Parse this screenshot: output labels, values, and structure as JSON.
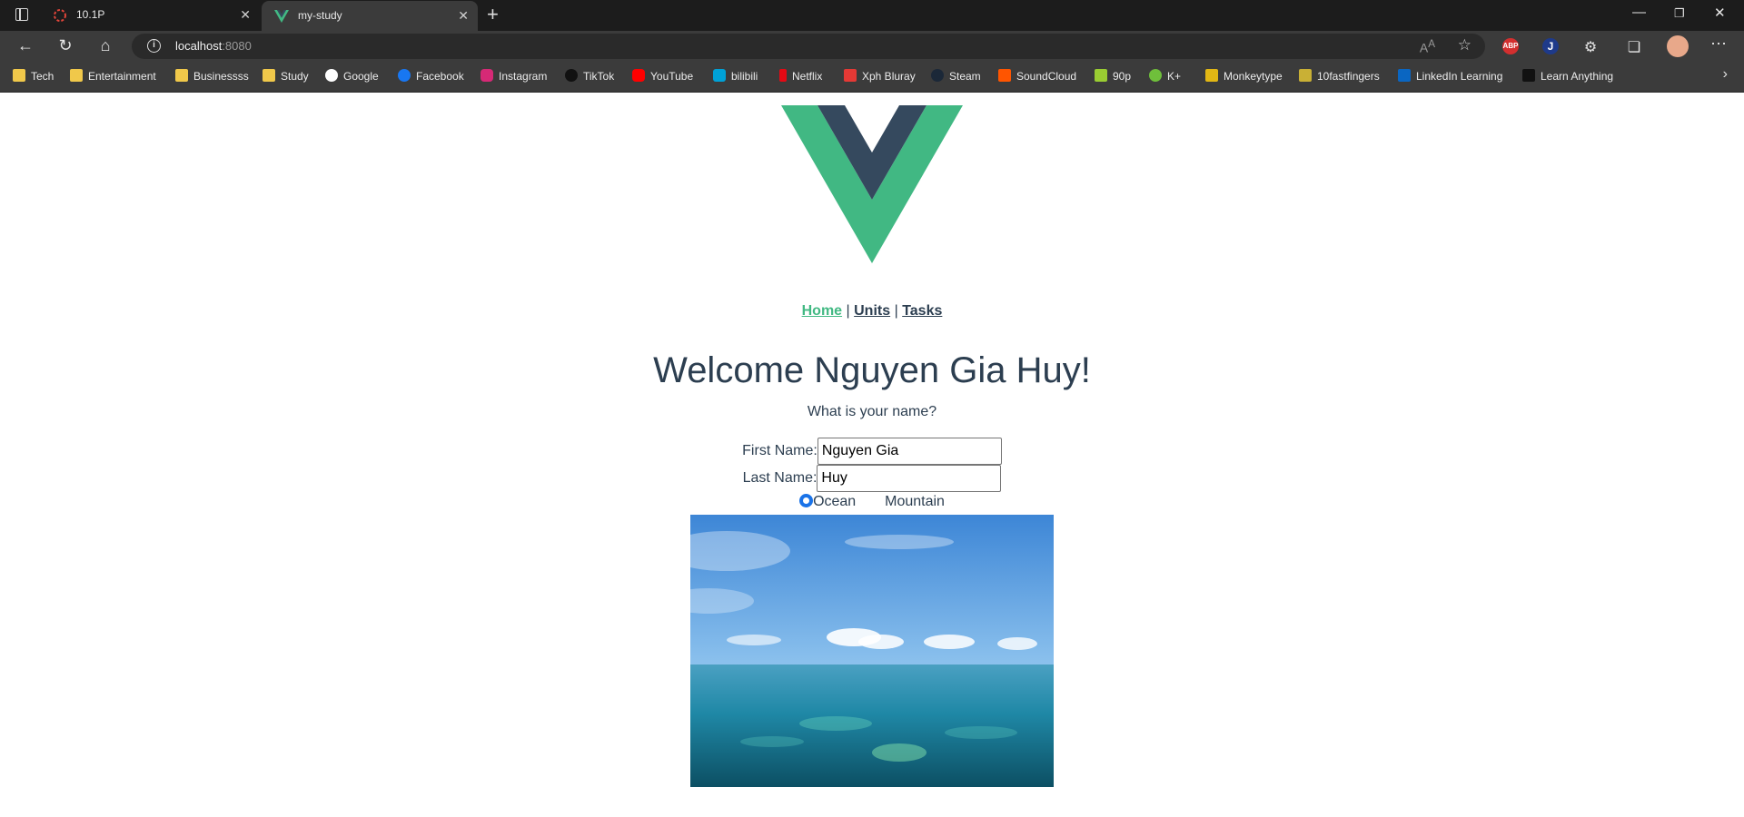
{
  "browser": {
    "tabs": [
      {
        "title": "10.1P",
        "active": false
      },
      {
        "title": "my-study",
        "active": true
      }
    ],
    "address": {
      "host": "localhost",
      "port": ":8080"
    },
    "bookmarks": [
      {
        "label": "Tech",
        "icon": "folder-icon"
      },
      {
        "label": "Entertainment",
        "icon": "folder-icon"
      },
      {
        "label": "Businessss",
        "icon": "folder-icon"
      },
      {
        "label": "Study",
        "icon": "folder-icon"
      },
      {
        "label": "Google",
        "icon": "google-icon"
      },
      {
        "label": "Facebook",
        "icon": "facebook-icon"
      },
      {
        "label": "Instagram",
        "icon": "instagram-icon"
      },
      {
        "label": "TikTok",
        "icon": "tiktok-icon"
      },
      {
        "label": "YouTube",
        "icon": "youtube-icon"
      },
      {
        "label": "bilibili",
        "icon": "bilibili-icon"
      },
      {
        "label": "Netflix",
        "icon": "netflix-icon"
      },
      {
        "label": "Xph Bluray",
        "icon": "xph-icon"
      },
      {
        "label": "Steam",
        "icon": "steam-icon"
      },
      {
        "label": "SoundCloud",
        "icon": "soundcloud-icon"
      },
      {
        "label": "90p",
        "icon": "90p-icon"
      },
      {
        "label": "K+",
        "icon": "kplus-icon"
      },
      {
        "label": "Monkeytype",
        "icon": "monkeytype-icon"
      },
      {
        "label": "10fastfingers",
        "icon": "10fastfingers-icon"
      },
      {
        "label": "LinkedIn Learning",
        "icon": "linkedin-learning-icon"
      },
      {
        "label": "Learn Anything",
        "icon": "learn-anything-icon"
      }
    ],
    "extensions": [
      {
        "label": "ABP",
        "color": "#d32f2f"
      },
      {
        "label": "J",
        "color": "#1e3a8a"
      }
    ]
  },
  "app": {
    "colors": {
      "accent": "#42b983",
      "text": "#2c3e50",
      "logo_dark": "#35495e"
    },
    "nav": [
      {
        "label": "Home",
        "active": true
      },
      {
        "label": "Units",
        "active": false
      },
      {
        "label": "Tasks",
        "active": false
      }
    ],
    "nav_separator": "|",
    "welcome": "Welcome Nguyen Gia Huy!",
    "question": "What is your name?",
    "form": {
      "first_name_label": "First Name:",
      "first_name_value": "Nguyen Gia",
      "last_name_label": "Last Name:",
      "last_name_value": "Huy"
    },
    "scene_options": [
      {
        "label": "Ocean",
        "selected": true
      },
      {
        "label": "Mountain",
        "selected": false
      }
    ]
  }
}
